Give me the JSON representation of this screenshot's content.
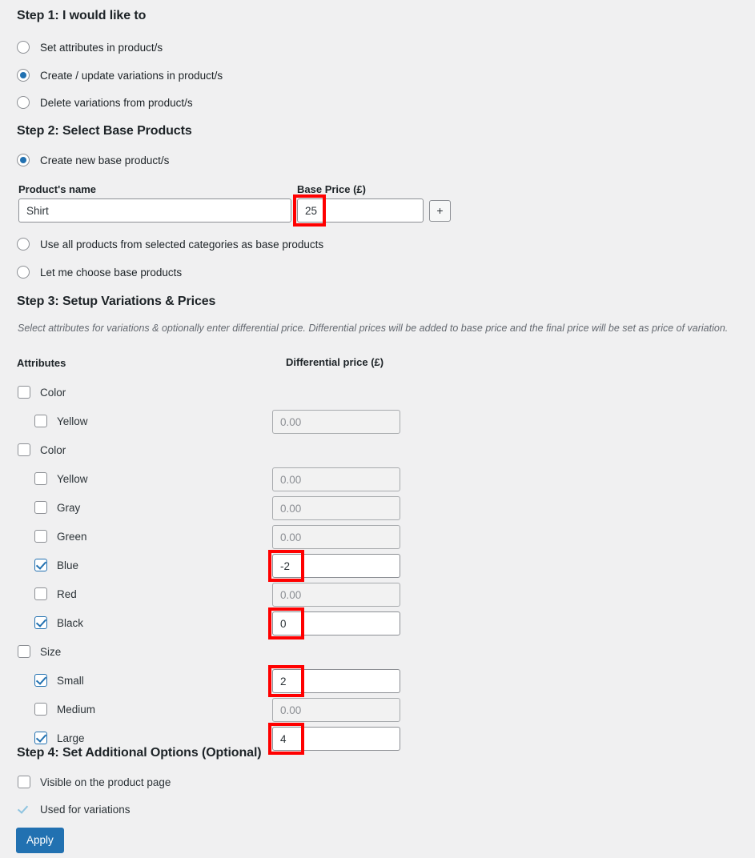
{
  "step1": {
    "title": "Step 1: I would like to",
    "options": [
      {
        "label": "Set attributes in product/s",
        "selected": false
      },
      {
        "label": "Create / update variations in product/s",
        "selected": true
      },
      {
        "label": "Delete variations from product/s",
        "selected": false
      }
    ]
  },
  "step2": {
    "title": "Step 2: Select Base Products",
    "options": [
      {
        "label": "Create new base product/s",
        "selected": true
      },
      {
        "label": "Use all products from selected categories as base products",
        "selected": false
      },
      {
        "label": "Let me choose base products",
        "selected": false
      }
    ],
    "product_name_label": "Product's name",
    "product_name_value": "Shirt",
    "base_price_label": "Base Price (£)",
    "base_price_value": "25",
    "add_button_label": "+"
  },
  "step3": {
    "title": "Step 3: Setup Variations & Prices",
    "note": "Select attributes for variations & optionally enter differential price. Differential prices will be added to base price and the final price will be set as price of variation.",
    "attributes_header": "Attributes",
    "price_header": "Differential price (£)",
    "placeholder": "0.00",
    "rows": [
      {
        "label": "Color",
        "level": "parent",
        "checked": false,
        "has_price": false,
        "value": "",
        "highlight": false
      },
      {
        "label": "Yellow",
        "level": "child",
        "checked": false,
        "has_price": true,
        "value": "",
        "highlight": false
      },
      {
        "label": "Color",
        "level": "parent",
        "checked": false,
        "has_price": false,
        "value": "",
        "highlight": false
      },
      {
        "label": "Yellow",
        "level": "child",
        "checked": false,
        "has_price": true,
        "value": "",
        "highlight": false
      },
      {
        "label": "Gray",
        "level": "child",
        "checked": false,
        "has_price": true,
        "value": "",
        "highlight": false
      },
      {
        "label": "Green",
        "level": "child",
        "checked": false,
        "has_price": true,
        "value": "",
        "highlight": false
      },
      {
        "label": "Blue",
        "level": "child",
        "checked": true,
        "has_price": true,
        "value": "-2",
        "highlight": true
      },
      {
        "label": "Red",
        "level": "child",
        "checked": false,
        "has_price": true,
        "value": "",
        "highlight": false
      },
      {
        "label": "Black",
        "level": "child",
        "checked": true,
        "has_price": true,
        "value": "0",
        "highlight": true
      },
      {
        "label": "Size",
        "level": "parent",
        "checked": false,
        "has_price": false,
        "value": "",
        "highlight": false
      },
      {
        "label": "Small",
        "level": "child",
        "checked": true,
        "has_price": true,
        "value": "2",
        "highlight": true
      },
      {
        "label": "Medium",
        "level": "child",
        "checked": false,
        "has_price": true,
        "value": "",
        "highlight": false
      },
      {
        "label": "Large",
        "level": "child",
        "checked": true,
        "has_price": true,
        "value": "4",
        "highlight": true
      }
    ]
  },
  "step4": {
    "title": "Step 4: Set Additional Options (Optional)",
    "options": [
      {
        "label": "Visible on the product page",
        "checked": false,
        "disabled": false
      },
      {
        "label": "Used for variations",
        "checked": true,
        "disabled": true
      }
    ],
    "apply_label": "Apply"
  },
  "colors": {
    "background": "#f0f0f1",
    "accent": "#2271b1",
    "highlight": "#ff0000",
    "text": "#1d2327",
    "muted": "#646970"
  }
}
